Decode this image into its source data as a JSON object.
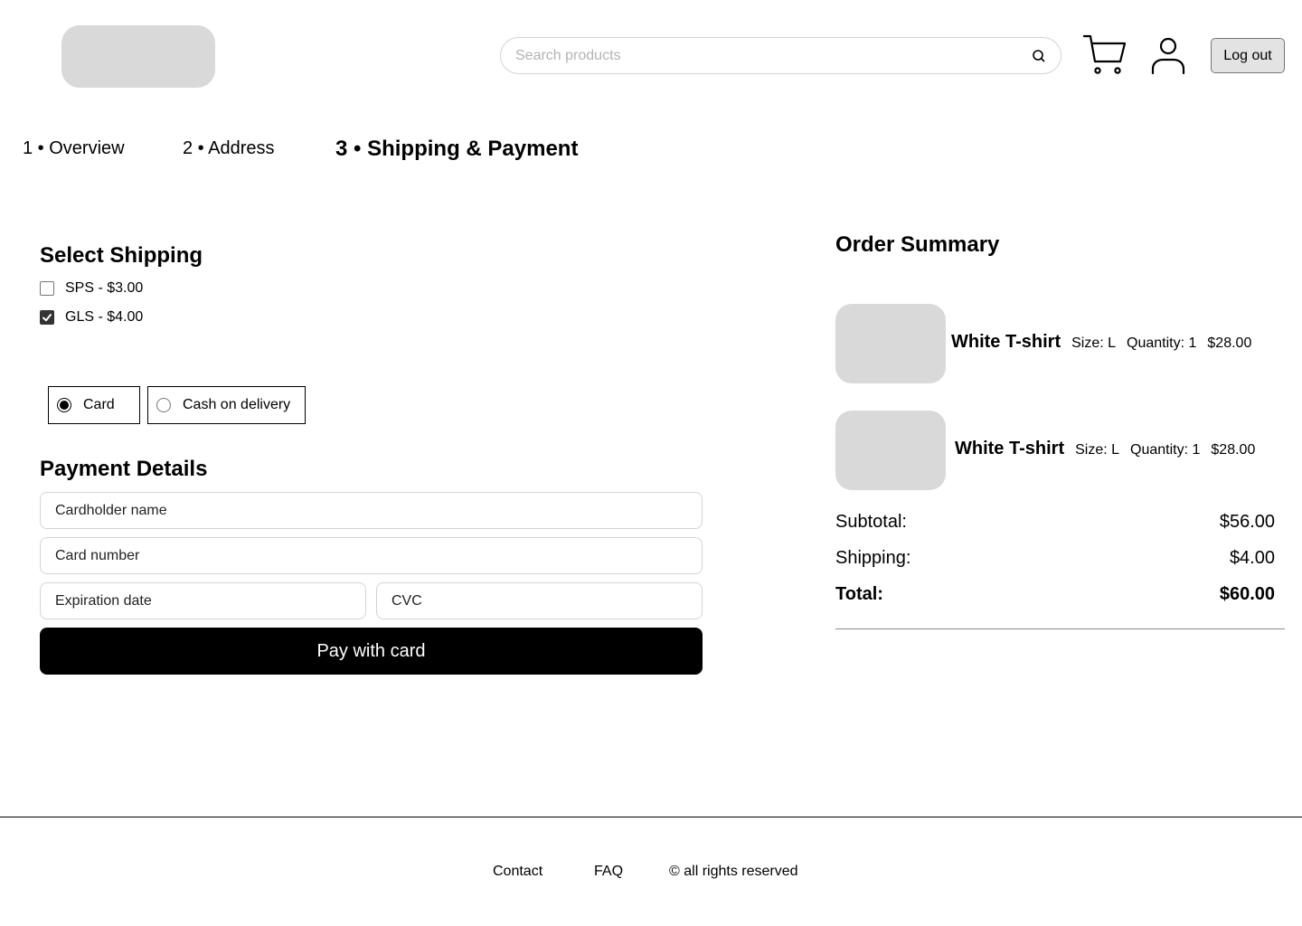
{
  "header": {
    "search_placeholder": "Search products",
    "logout_label": "Log out"
  },
  "steps": [
    {
      "label": "1 • Overview",
      "active": false
    },
    {
      "label": "2 • Address",
      "active": false
    },
    {
      "label": "3 • Shipping & Payment",
      "active": true
    }
  ],
  "shipping": {
    "title": "Select Shipping",
    "options": [
      {
        "label": "SPS - $3.00",
        "checked": false
      },
      {
        "label": "GLS - $4.00",
        "checked": true
      }
    ]
  },
  "payment_methods": [
    {
      "label": "Card",
      "selected": true
    },
    {
      "label": "Cash on delivery",
      "selected": false
    }
  ],
  "payment": {
    "title": "Payment Details",
    "cardholder_placeholder": "Cardholder name",
    "card_number_placeholder": "Card number",
    "expiration_placeholder": "Expiration date",
    "cvc_placeholder": "CVC",
    "pay_label": "Pay with card"
  },
  "summary": {
    "title": "Order Summary",
    "items": [
      {
        "name": "White T-shirt",
        "size": "Size: L",
        "quantity": "Quantity: 1",
        "price": "$28.00"
      },
      {
        "name": "White T-shirt",
        "size": "Size: L",
        "quantity": "Quantity: 1",
        "price": "$28.00"
      }
    ],
    "subtotal_label": "Subtotal:",
    "subtotal_value": "$56.00",
    "shipping_label": "Shipping:",
    "shipping_value": "$4.00",
    "total_label": "Total:",
    "total_value": "$60.00"
  },
  "footer": {
    "contact": "Contact",
    "faq": "FAQ",
    "rights": "© all rights reserved"
  },
  "icons": {
    "search": "search-icon",
    "cart": "cart-icon",
    "user": "user-icon",
    "check": "check-icon"
  },
  "colors": {
    "placeholder_block": "#d9d9d9",
    "primary_button": "#000000",
    "checkbox_checked": "#333333"
  }
}
